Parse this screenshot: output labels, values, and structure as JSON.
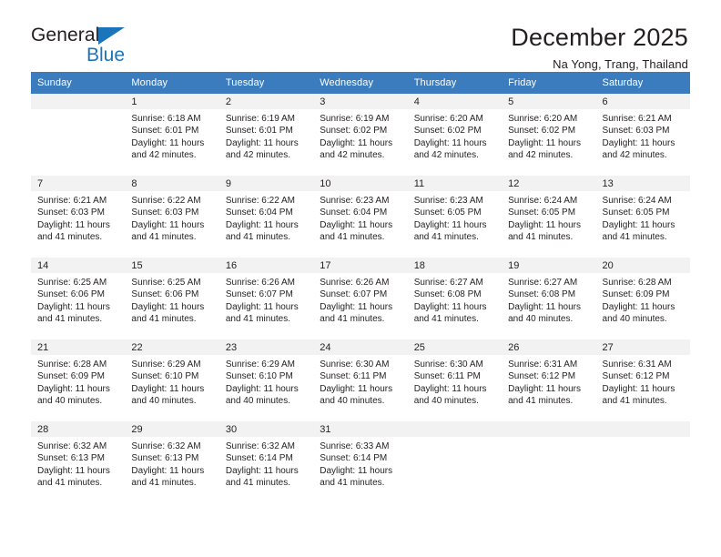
{
  "brand": {
    "name_top": "General",
    "name_bottom": "Blue",
    "triangle_color": "#1b75bb"
  },
  "header": {
    "title": "December 2025",
    "subtitle": "Na Yong, Trang, Thailand"
  },
  "theme": {
    "header_row_bg": "#3a7cbe",
    "header_row_text": "#ffffff",
    "daynum_band_bg": "#f2f2f2",
    "separator": "#d4d4d4",
    "text": "#231f20"
  },
  "weekday_headers": [
    "Sunday",
    "Monday",
    "Tuesday",
    "Wednesday",
    "Thursday",
    "Friday",
    "Saturday"
  ],
  "labels": {
    "sunrise_prefix": "Sunrise:",
    "sunset_prefix": "Sunset:",
    "daylight_prefix": "Daylight:"
  },
  "weeks": [
    [
      {
        "day": "",
        "empty": true
      },
      {
        "day": "1",
        "sunrise": "Sunrise: 6:18 AM",
        "sunset": "Sunset: 6:01 PM",
        "daylight": "Daylight: 11 hours and 42 minutes."
      },
      {
        "day": "2",
        "sunrise": "Sunrise: 6:19 AM",
        "sunset": "Sunset: 6:01 PM",
        "daylight": "Daylight: 11 hours and 42 minutes."
      },
      {
        "day": "3",
        "sunrise": "Sunrise: 6:19 AM",
        "sunset": "Sunset: 6:02 PM",
        "daylight": "Daylight: 11 hours and 42 minutes."
      },
      {
        "day": "4",
        "sunrise": "Sunrise: 6:20 AM",
        "sunset": "Sunset: 6:02 PM",
        "daylight": "Daylight: 11 hours and 42 minutes."
      },
      {
        "day": "5",
        "sunrise": "Sunrise: 6:20 AM",
        "sunset": "Sunset: 6:02 PM",
        "daylight": "Daylight: 11 hours and 42 minutes."
      },
      {
        "day": "6",
        "sunrise": "Sunrise: 6:21 AM",
        "sunset": "Sunset: 6:03 PM",
        "daylight": "Daylight: 11 hours and 42 minutes."
      }
    ],
    [
      {
        "day": "7",
        "sunrise": "Sunrise: 6:21 AM",
        "sunset": "Sunset: 6:03 PM",
        "daylight": "Daylight: 11 hours and 41 minutes."
      },
      {
        "day": "8",
        "sunrise": "Sunrise: 6:22 AM",
        "sunset": "Sunset: 6:03 PM",
        "daylight": "Daylight: 11 hours and 41 minutes."
      },
      {
        "day": "9",
        "sunrise": "Sunrise: 6:22 AM",
        "sunset": "Sunset: 6:04 PM",
        "daylight": "Daylight: 11 hours and 41 minutes."
      },
      {
        "day": "10",
        "sunrise": "Sunrise: 6:23 AM",
        "sunset": "Sunset: 6:04 PM",
        "daylight": "Daylight: 11 hours and 41 minutes."
      },
      {
        "day": "11",
        "sunrise": "Sunrise: 6:23 AM",
        "sunset": "Sunset: 6:05 PM",
        "daylight": "Daylight: 11 hours and 41 minutes."
      },
      {
        "day": "12",
        "sunrise": "Sunrise: 6:24 AM",
        "sunset": "Sunset: 6:05 PM",
        "daylight": "Daylight: 11 hours and 41 minutes."
      },
      {
        "day": "13",
        "sunrise": "Sunrise: 6:24 AM",
        "sunset": "Sunset: 6:05 PM",
        "daylight": "Daylight: 11 hours and 41 minutes."
      }
    ],
    [
      {
        "day": "14",
        "sunrise": "Sunrise: 6:25 AM",
        "sunset": "Sunset: 6:06 PM",
        "daylight": "Daylight: 11 hours and 41 minutes."
      },
      {
        "day": "15",
        "sunrise": "Sunrise: 6:25 AM",
        "sunset": "Sunset: 6:06 PM",
        "daylight": "Daylight: 11 hours and 41 minutes."
      },
      {
        "day": "16",
        "sunrise": "Sunrise: 6:26 AM",
        "sunset": "Sunset: 6:07 PM",
        "daylight": "Daylight: 11 hours and 41 minutes."
      },
      {
        "day": "17",
        "sunrise": "Sunrise: 6:26 AM",
        "sunset": "Sunset: 6:07 PM",
        "daylight": "Daylight: 11 hours and 41 minutes."
      },
      {
        "day": "18",
        "sunrise": "Sunrise: 6:27 AM",
        "sunset": "Sunset: 6:08 PM",
        "daylight": "Daylight: 11 hours and 41 minutes."
      },
      {
        "day": "19",
        "sunrise": "Sunrise: 6:27 AM",
        "sunset": "Sunset: 6:08 PM",
        "daylight": "Daylight: 11 hours and 40 minutes."
      },
      {
        "day": "20",
        "sunrise": "Sunrise: 6:28 AM",
        "sunset": "Sunset: 6:09 PM",
        "daylight": "Daylight: 11 hours and 40 minutes."
      }
    ],
    [
      {
        "day": "21",
        "sunrise": "Sunrise: 6:28 AM",
        "sunset": "Sunset: 6:09 PM",
        "daylight": "Daylight: 11 hours and 40 minutes."
      },
      {
        "day": "22",
        "sunrise": "Sunrise: 6:29 AM",
        "sunset": "Sunset: 6:10 PM",
        "daylight": "Daylight: 11 hours and 40 minutes."
      },
      {
        "day": "23",
        "sunrise": "Sunrise: 6:29 AM",
        "sunset": "Sunset: 6:10 PM",
        "daylight": "Daylight: 11 hours and 40 minutes."
      },
      {
        "day": "24",
        "sunrise": "Sunrise: 6:30 AM",
        "sunset": "Sunset: 6:11 PM",
        "daylight": "Daylight: 11 hours and 40 minutes."
      },
      {
        "day": "25",
        "sunrise": "Sunrise: 6:30 AM",
        "sunset": "Sunset: 6:11 PM",
        "daylight": "Daylight: 11 hours and 40 minutes."
      },
      {
        "day": "26",
        "sunrise": "Sunrise: 6:31 AM",
        "sunset": "Sunset: 6:12 PM",
        "daylight": "Daylight: 11 hours and 41 minutes."
      },
      {
        "day": "27",
        "sunrise": "Sunrise: 6:31 AM",
        "sunset": "Sunset: 6:12 PM",
        "daylight": "Daylight: 11 hours and 41 minutes."
      }
    ],
    [
      {
        "day": "28",
        "sunrise": "Sunrise: 6:32 AM",
        "sunset": "Sunset: 6:13 PM",
        "daylight": "Daylight: 11 hours and 41 minutes."
      },
      {
        "day": "29",
        "sunrise": "Sunrise: 6:32 AM",
        "sunset": "Sunset: 6:13 PM",
        "daylight": "Daylight: 11 hours and 41 minutes."
      },
      {
        "day": "30",
        "sunrise": "Sunrise: 6:32 AM",
        "sunset": "Sunset: 6:14 PM",
        "daylight": "Daylight: 11 hours and 41 minutes."
      },
      {
        "day": "31",
        "sunrise": "Sunrise: 6:33 AM",
        "sunset": "Sunset: 6:14 PM",
        "daylight": "Daylight: 11 hours and 41 minutes."
      },
      {
        "day": "",
        "empty": true
      },
      {
        "day": "",
        "empty": true
      },
      {
        "day": "",
        "empty": true
      }
    ]
  ]
}
